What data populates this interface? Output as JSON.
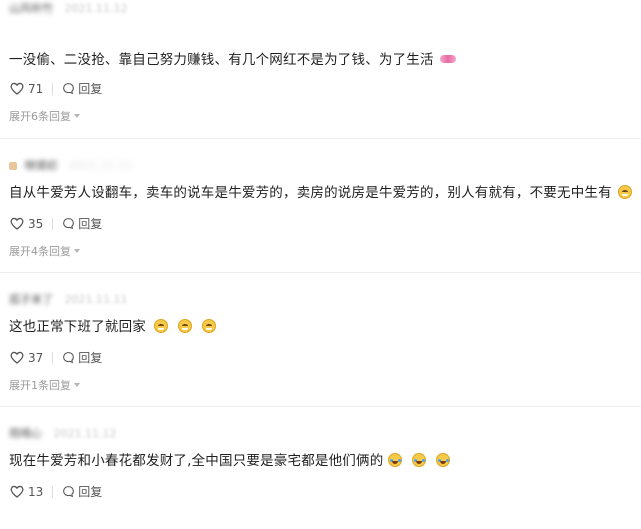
{
  "comments": [
    {
      "username": "山风听竹",
      "date": "2021.11.12",
      "text": "一没偷、二没抢、靠自己努力赚钱、有几个网红不是为了钱、为了生活",
      "emoji_icons": [
        "hearts-emoji-icon"
      ],
      "likes": "71",
      "reply_label": "回复",
      "expand_label": "展开6条回复"
    },
    {
      "username": "晓镜初",
      "date": "2021.11.11",
      "text": "自从牛爱芳人设翻车，卖车的说车是牛爱芳的，卖房的说房是牛爱芳的，别人有就有，不要无中生有",
      "emoji_icons": [
        "grin-emoji-icon"
      ],
      "likes": "35",
      "reply_label": "回复",
      "expand_label": "展开4条回复"
    },
    {
      "username": "孤子来了",
      "date": "2021.11.11",
      "text": "这也正常下班了就回家",
      "emoji_icons": [
        "grin-emoji-icon",
        "grin-emoji-icon",
        "grin-emoji-icon"
      ],
      "likes": "37",
      "reply_label": "回复",
      "expand_label": "展开1条回复"
    },
    {
      "username": "雨晴心",
      "date": "2021.11.12",
      "text": "现在牛爱芳和小春花都发财了,全中国只要是豪宅都是他们俩的",
      "emoji_icons": [
        "laugh-emoji-icon",
        "laugh-emoji-icon",
        "laugh-emoji-icon"
      ],
      "likes": "13",
      "reply_label": "回复",
      "expand_label": ""
    }
  ],
  "colors": {
    "text": "#1f1f1f",
    "meta": "#9a9a9a",
    "divider": "#eeeeee"
  }
}
